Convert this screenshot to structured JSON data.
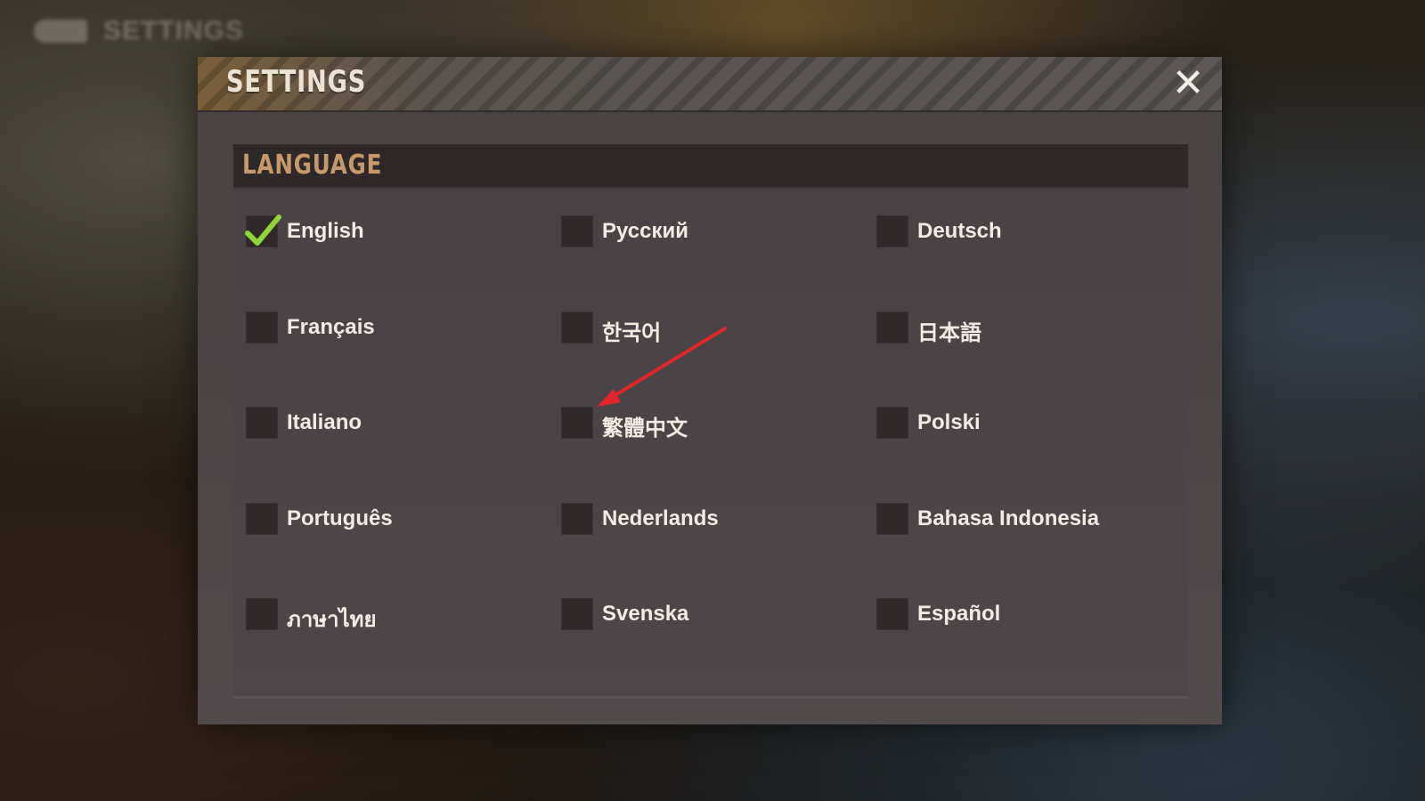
{
  "background": {
    "back_label": "SETTINGS"
  },
  "dialog": {
    "title": "SETTINGS",
    "close_icon": "close-icon",
    "close_glyph": "✕"
  },
  "language_section": {
    "title": "LANGUAGE",
    "selected": "English",
    "options": [
      {
        "label": "English",
        "checked": true
      },
      {
        "label": "Русский",
        "checked": false
      },
      {
        "label": "Deutsch",
        "checked": false
      },
      {
        "label": "Français",
        "checked": false
      },
      {
        "label": "한국어",
        "checked": false
      },
      {
        "label": "日本語",
        "checked": false
      },
      {
        "label": "Italiano",
        "checked": false
      },
      {
        "label": "繁體中文",
        "checked": false
      },
      {
        "label": "Polski",
        "checked": false
      },
      {
        "label": "Português",
        "checked": false
      },
      {
        "label": "Nederlands",
        "checked": false
      },
      {
        "label": "Bahasa Indonesia",
        "checked": false
      },
      {
        "label": "ภาษาไทย",
        "checked": false
      },
      {
        "label": "Svenska",
        "checked": false
      },
      {
        "label": "Español",
        "checked": false
      }
    ]
  },
  "annotation": {
    "arrow_icon": "red-arrow-icon",
    "points_to": "繁體中文"
  },
  "colors": {
    "check": "#8fd43a",
    "section_title": "#c5996a",
    "annotation": "#e0262b"
  }
}
